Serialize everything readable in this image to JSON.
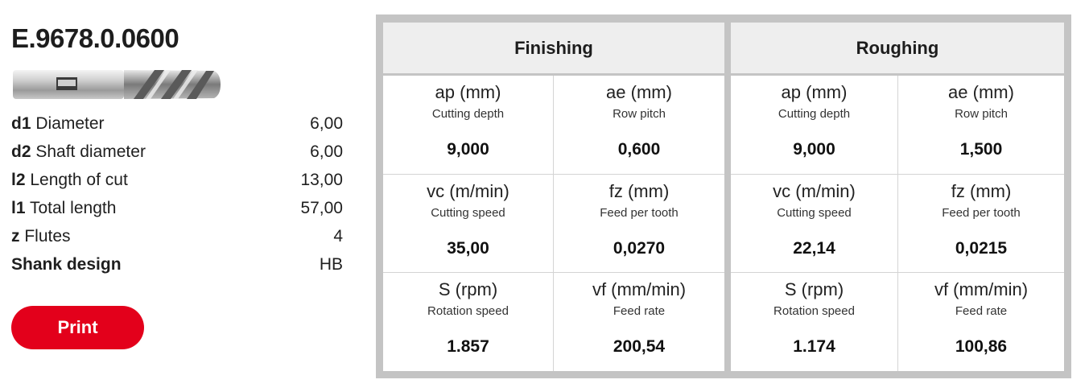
{
  "article_number": "E.9678.0.0600",
  "specs": [
    {
      "symbol": "d1",
      "name": "Diameter",
      "value": "6,00"
    },
    {
      "symbol": "d2",
      "name": "Shaft diameter",
      "value": "6,00"
    },
    {
      "symbol": "l2",
      "name": "Length of cut",
      "value": "13,00"
    },
    {
      "symbol": "l1",
      "name": "Total length",
      "value": "57,00"
    },
    {
      "symbol": "z",
      "name": "Flutes",
      "value": "4"
    },
    {
      "symbol": "",
      "name": "Shank design",
      "value": "HB"
    }
  ],
  "print_label": "Print",
  "finishing": {
    "title": "Finishing",
    "cells": [
      {
        "param": "ap (mm)",
        "desc": "Cutting depth",
        "value": "9,000"
      },
      {
        "param": "ae (mm)",
        "desc": "Row pitch",
        "value": "0,600"
      },
      {
        "param": "vc (m/min)",
        "desc": "Cutting speed",
        "value": "35,00"
      },
      {
        "param": "fz (mm)",
        "desc": "Feed per tooth",
        "value": "0,0270"
      },
      {
        "param": "S (rpm)",
        "desc": "Rotation speed",
        "value": "1.857"
      },
      {
        "param": "vf (mm/min)",
        "desc": "Feed rate",
        "value": "200,54"
      }
    ]
  },
  "roughing": {
    "title": "Roughing",
    "cells": [
      {
        "param": "ap (mm)",
        "desc": "Cutting depth",
        "value": "9,000"
      },
      {
        "param": "ae (mm)",
        "desc": "Row pitch",
        "value": "1,500"
      },
      {
        "param": "vc (m/min)",
        "desc": "Cutting speed",
        "value": "22,14"
      },
      {
        "param": "fz (mm)",
        "desc": "Feed per tooth",
        "value": "0,0215"
      },
      {
        "param": "S (rpm)",
        "desc": "Rotation speed",
        "value": "1.174"
      },
      {
        "param": "vf (mm/min)",
        "desc": "Feed rate",
        "value": "100,86"
      }
    ]
  },
  "colors": {
    "accent": "#e3001b",
    "panel_border": "#c4c4c4",
    "header_bg": "#eeeeee"
  },
  "icons": {
    "tool": "end-mill-image"
  }
}
